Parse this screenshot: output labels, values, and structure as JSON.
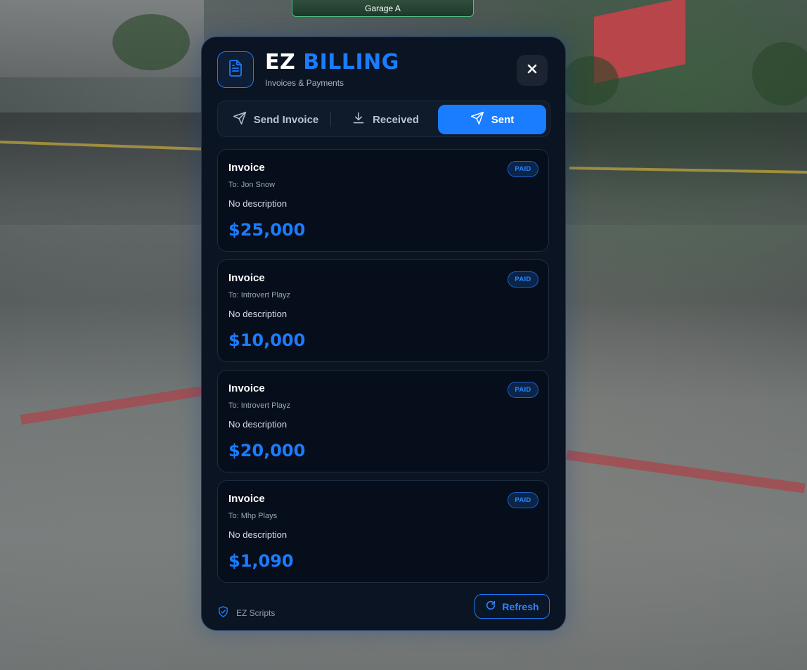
{
  "overlay": {
    "garage_label": "Garage A"
  },
  "header": {
    "title_part1": "EZ",
    "title_part2": "BILLING",
    "subtitle": "Invoices & Payments",
    "icon": "document-icon",
    "close_icon": "close-icon"
  },
  "tabs": [
    {
      "label": "Send Invoice",
      "icon": "send-icon",
      "active": false
    },
    {
      "label": "Received",
      "icon": "download-icon",
      "active": false
    },
    {
      "label": "Sent",
      "icon": "send-icon",
      "active": true
    }
  ],
  "invoices": [
    {
      "title": "Invoice",
      "to": "To: Jon Snow",
      "description": "No description",
      "amount": "$25,000",
      "status": "PAID"
    },
    {
      "title": "Invoice",
      "to": "To: Introvert Playz",
      "description": "No description",
      "amount": "$10,000",
      "status": "PAID"
    },
    {
      "title": "Invoice",
      "to": "To: Introvert Playz",
      "description": "No description",
      "amount": "$20,000",
      "status": "PAID"
    },
    {
      "title": "Invoice",
      "to": "To: Mhp Plays",
      "description": "No description",
      "amount": "$1,090",
      "status": "PAID"
    }
  ],
  "footer": {
    "brand": "EZ Scripts",
    "brand_icon": "shield-check-icon",
    "refresh_label": "Refresh",
    "refresh_icon": "refresh-icon"
  },
  "colors": {
    "accent": "#1a7cff",
    "panel_bg": "#0b1422",
    "card_bg": "#070e1b"
  }
}
